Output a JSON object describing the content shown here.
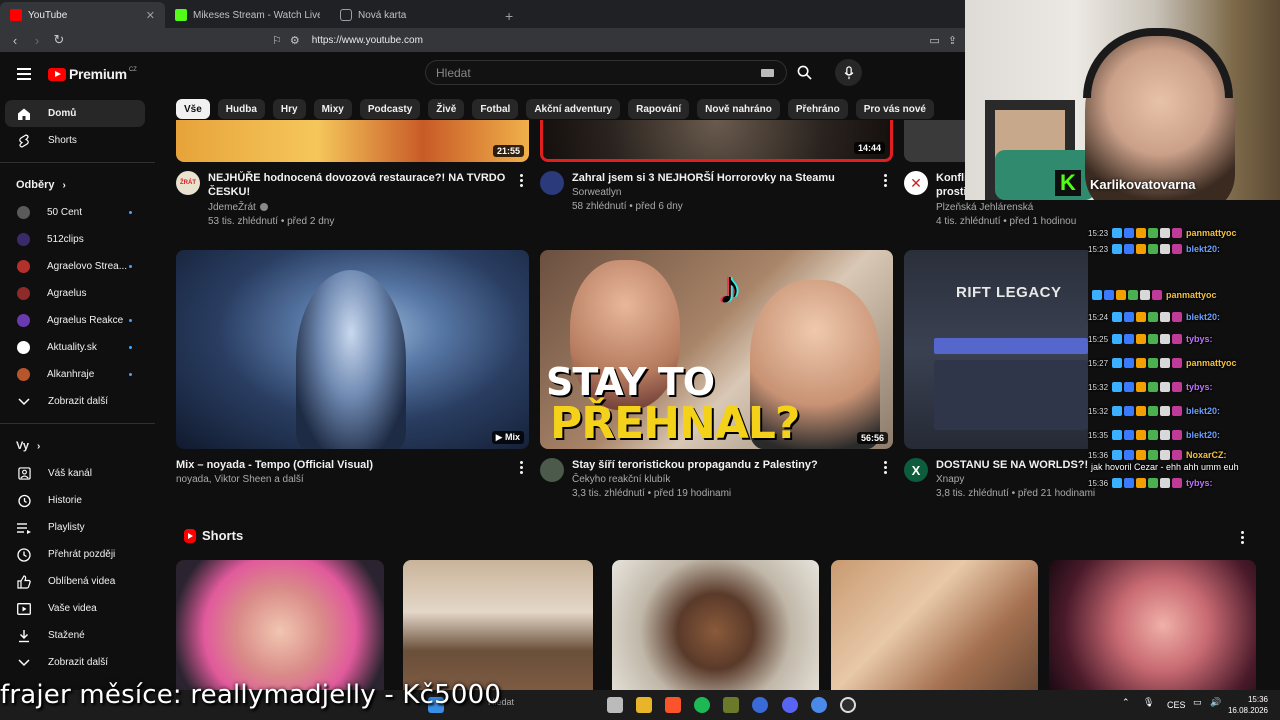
{
  "browser": {
    "tabs": [
      {
        "title": "YouTube",
        "active": true,
        "favicon_color": "#ff0000"
      },
      {
        "title": "Mikeses Stream - Watch Live on Kick",
        "active": false,
        "favicon_color": "#53fc18"
      },
      {
        "title": "Nová karta",
        "active": false,
        "favicon_color": "#9aa0a6"
      }
    ],
    "url": "https://www.youtube.com"
  },
  "header": {
    "logo_text": "Premium",
    "logo_sup": "CZ",
    "search_placeholder": "Hledat"
  },
  "chips": [
    "Vše",
    "Hudba",
    "Hry",
    "Mixy",
    "Podcasty",
    "Živě",
    "Fotbal",
    "Akční adventury",
    "Rapování",
    "Nově nahráno",
    "Přehráno",
    "Pro vás nové"
  ],
  "sidebar": {
    "main": [
      {
        "label": "Domů",
        "icon": "home-icon",
        "active": true
      },
      {
        "label": "Shorts",
        "icon": "shorts-icon",
        "active": false
      }
    ],
    "subscriptions_heading": "Odběry",
    "subscriptions": [
      {
        "label": "50 Cent",
        "color": "#5a5a5a",
        "dot": true
      },
      {
        "label": "512clips",
        "color": "#3b2a6a",
        "dot": false
      },
      {
        "label": "Agraelovo Strea...",
        "color": "#b3302b",
        "dot": true
      },
      {
        "label": "Agraelus",
        "color": "#8d2a2a",
        "dot": false
      },
      {
        "label": "Agraelus Reakce",
        "color": "#6a3ab0",
        "dot": true
      },
      {
        "label": "Aktuality.sk",
        "color": "#ffffff",
        "dot": true
      },
      {
        "label": "Alkanhraje",
        "color": "#b7562a",
        "dot": true
      }
    ],
    "show_more": "Zobrazit další",
    "you_heading": "Vy",
    "you_items": [
      {
        "label": "Váš kanál",
        "icon": "channel-icon"
      },
      {
        "label": "Historie",
        "icon": "history-icon"
      },
      {
        "label": "Playlisty",
        "icon": "playlist-icon"
      },
      {
        "label": "Přehrát později",
        "icon": "watch-later-icon"
      },
      {
        "label": "Oblíbená videa",
        "icon": "like-icon"
      },
      {
        "label": "Vaše videa",
        "icon": "your-videos-icon"
      },
      {
        "label": "Stažené",
        "icon": "download-icon"
      },
      {
        "label": "Zobrazit další",
        "icon": "chevron-down-icon"
      }
    ]
  },
  "videos_row1": [
    {
      "title_line1": "NEJHŮŘE hodnocená dovozová restaurace?! NA TVRDO PO",
      "title_line2": "ČESKU!",
      "channel": "JdemeŽrát",
      "stats": "53 tis. zhlédnutí • před 2 dny",
      "duration": "21:55",
      "avatar_color": "#e9e2cf"
    },
    {
      "title_line1": "Zahral jsem si 3 NEJHORŠÍ Horrorovky na Steamu",
      "title_line2": "",
      "channel": "Sorweatlyn",
      "stats": "58 zhlédnutí • před 6 dny",
      "duration": "14:44",
      "avatar_color": "#2a3a7a"
    },
    {
      "title_line1": "Konfli",
      "title_line2": "prostř",
      "channel": "Plzeňská Jehlárenská",
      "stats": "4 tis. zhlédnutí • před 1 hodinou",
      "duration": "",
      "avatar_color": "#ffffff"
    }
  ],
  "videos_row2": [
    {
      "title_line1": "Mix – noyada - Tempo (Official Visual)",
      "channel": "noyada, Viktor Sheen a další",
      "stats": "",
      "duration": "Mix",
      "avatar": false
    },
    {
      "title_line1": "Stay šíří teroristickou propagandu z Palestiny?",
      "channel": "Čekyho reakční klubík",
      "stats": "3,3 tis. zhlédnutí • před 19 hodinami",
      "duration": "56:56",
      "avatar": true,
      "thumb_top": "STAY TO",
      "thumb_bottom": "PŘEHNAL?"
    },
    {
      "title_line1": "DOSTANU SE NA WORLDS?!",
      "channel": "Xnapy",
      "stats": "3,8 tis. zhlédnutí • před 21 hodinami",
      "duration": "",
      "avatar": true,
      "thumb_title": "RIFT LEGACY"
    }
  ],
  "shorts_heading": "Shorts",
  "overlay": {
    "streamer": "Karlikovatovarna",
    "chat": [
      {
        "time": "15:23",
        "user": "panmattyoc",
        "msg": ""
      },
      {
        "time": "15:23",
        "user": "blekt20:",
        "msg": ""
      },
      {
        "time": "",
        "user": "panmattyoc",
        "msg": ""
      },
      {
        "time": "15:24",
        "user": "blekt20:",
        "msg": ""
      },
      {
        "time": "15:25",
        "user": "tybys:",
        "msg": ""
      },
      {
        "time": "15:27",
        "user": "panmattyoc",
        "msg": ""
      },
      {
        "time": "15:32",
        "user": "tybys:",
        "msg": ""
      },
      {
        "time": "15:32",
        "user": "blekt20:",
        "msg": ""
      },
      {
        "time": "15:35",
        "user": "blekt20:",
        "msg": ""
      },
      {
        "time": "15:36",
        "user": "NoxarCZ:",
        "msg": "jak hovoril Cezar - ehh ahh umm euh"
      },
      {
        "time": "15:36",
        "user": "tybys:",
        "msg": ""
      }
    ],
    "ticker": "frajer měsíce: reallymadjelly - Kč5000"
  },
  "taskbar": {
    "search": "Hledat",
    "lang": "CES",
    "time": "15:36",
    "date": "16.08.2026"
  }
}
